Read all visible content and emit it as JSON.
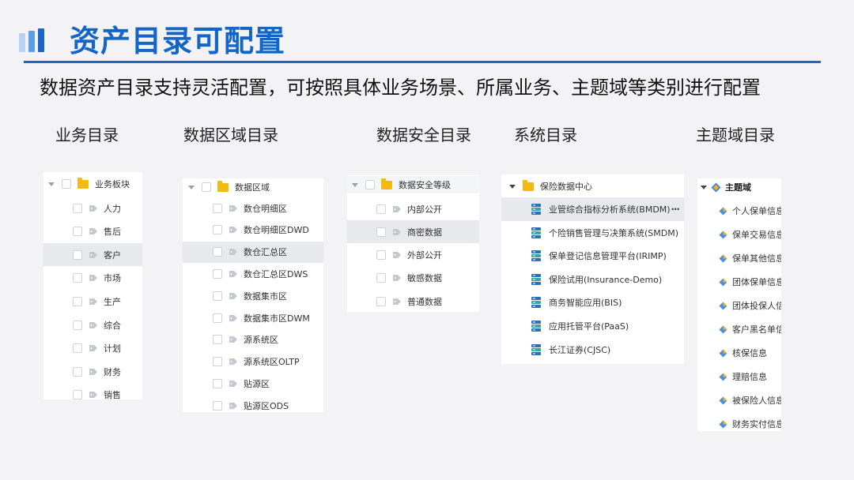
{
  "header": {
    "title": "资产目录可配置",
    "subtitle": "数据资产目录支持灵活配置，可按照具体业务场景、所属业务、主题域等类别进行配置"
  },
  "colors": {
    "accent": "#1565c8",
    "folder": "#f5b914",
    "selected_row": "#e8e9ed"
  },
  "columns": [
    {
      "heading": "业务目录",
      "root": "业务板块",
      "items": [
        "人力",
        "售后",
        "客户",
        "市场",
        "生产",
        "综合",
        "计划",
        "财务",
        "销售"
      ],
      "selected": "客户"
    },
    {
      "heading": "数据区域目录",
      "root": "数据区域",
      "items": [
        "数仓明细区",
        "数仓明细区DWD",
        "数仓汇总区",
        "数仓汇总区DWS",
        "数据集市区",
        "数据集市区DWM",
        "源系统区",
        "源系统区OLTP",
        "贴源区",
        "贴源区ODS"
      ],
      "selected": "数仓汇总区"
    },
    {
      "heading": "数据安全目录",
      "root": "数据安全等级",
      "items": [
        "内部公开",
        "商密数据",
        "外部公开",
        "敏感数据",
        "普通数据"
      ],
      "selected": "商密数据"
    },
    {
      "heading": "系统目录",
      "root": "保险数据中心",
      "items": [
        "业管综合指标分析系统(BMDM)",
        "个险销售管理与决策系统(SMDM)",
        "保单登记信息管理平台(IRIMP)",
        "保险试用(Insurance-Demo)",
        "商务智能应用(BIS)",
        "应用托管平台(PaaS)",
        "长江证券(CJSC)"
      ],
      "selected": "业管综合指标分析系统(BMDM)",
      "more_label": "···"
    },
    {
      "heading": "主题域目录",
      "root": "主题域",
      "items": [
        "个人保单信息",
        "保单交易信息",
        "保单其他信息",
        "团体保单信息",
        "团体投保人信息",
        "客户黑名单信息",
        "核保信息",
        "理赔信息",
        "被保险人信息",
        "财务实付信息"
      ]
    }
  ]
}
